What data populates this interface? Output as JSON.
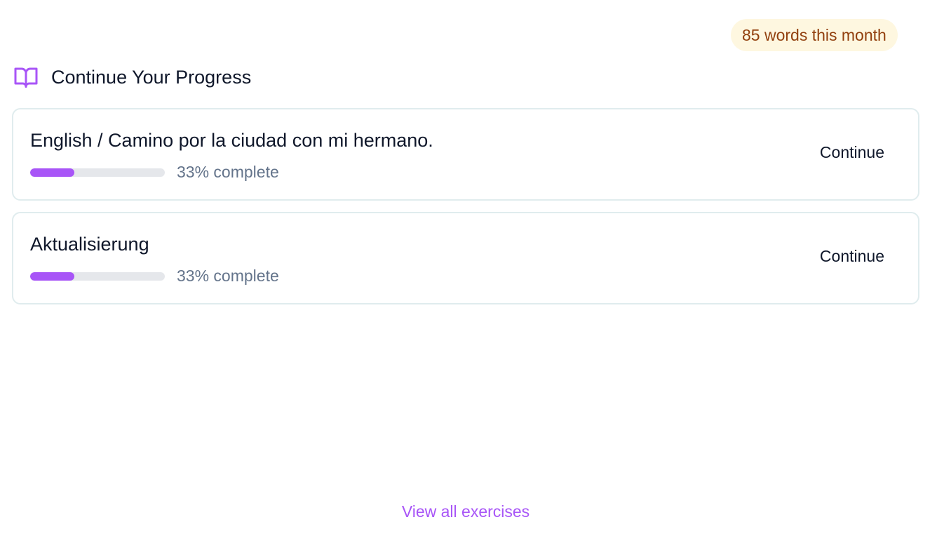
{
  "badge": {
    "text": "85 words this month",
    "bg_color": "#fef7e0",
    "text_color": "#92400e"
  },
  "section": {
    "icon": "book-open-icon",
    "icon_color": "#a855f7",
    "title": "Continue Your Progress"
  },
  "exercises": [
    {
      "title": "English / Camino por la ciudad con mi hermano.",
      "progress": 0.33,
      "progress_label": "33% complete",
      "action_label": "Continue"
    },
    {
      "title": "Aktualisierung",
      "progress": 0.33,
      "progress_label": "33% complete",
      "action_label": "Continue"
    }
  ],
  "progress_color": "#a855f7",
  "footer": {
    "view_all_label": "View all exercises",
    "link_color": "#a855f7"
  }
}
